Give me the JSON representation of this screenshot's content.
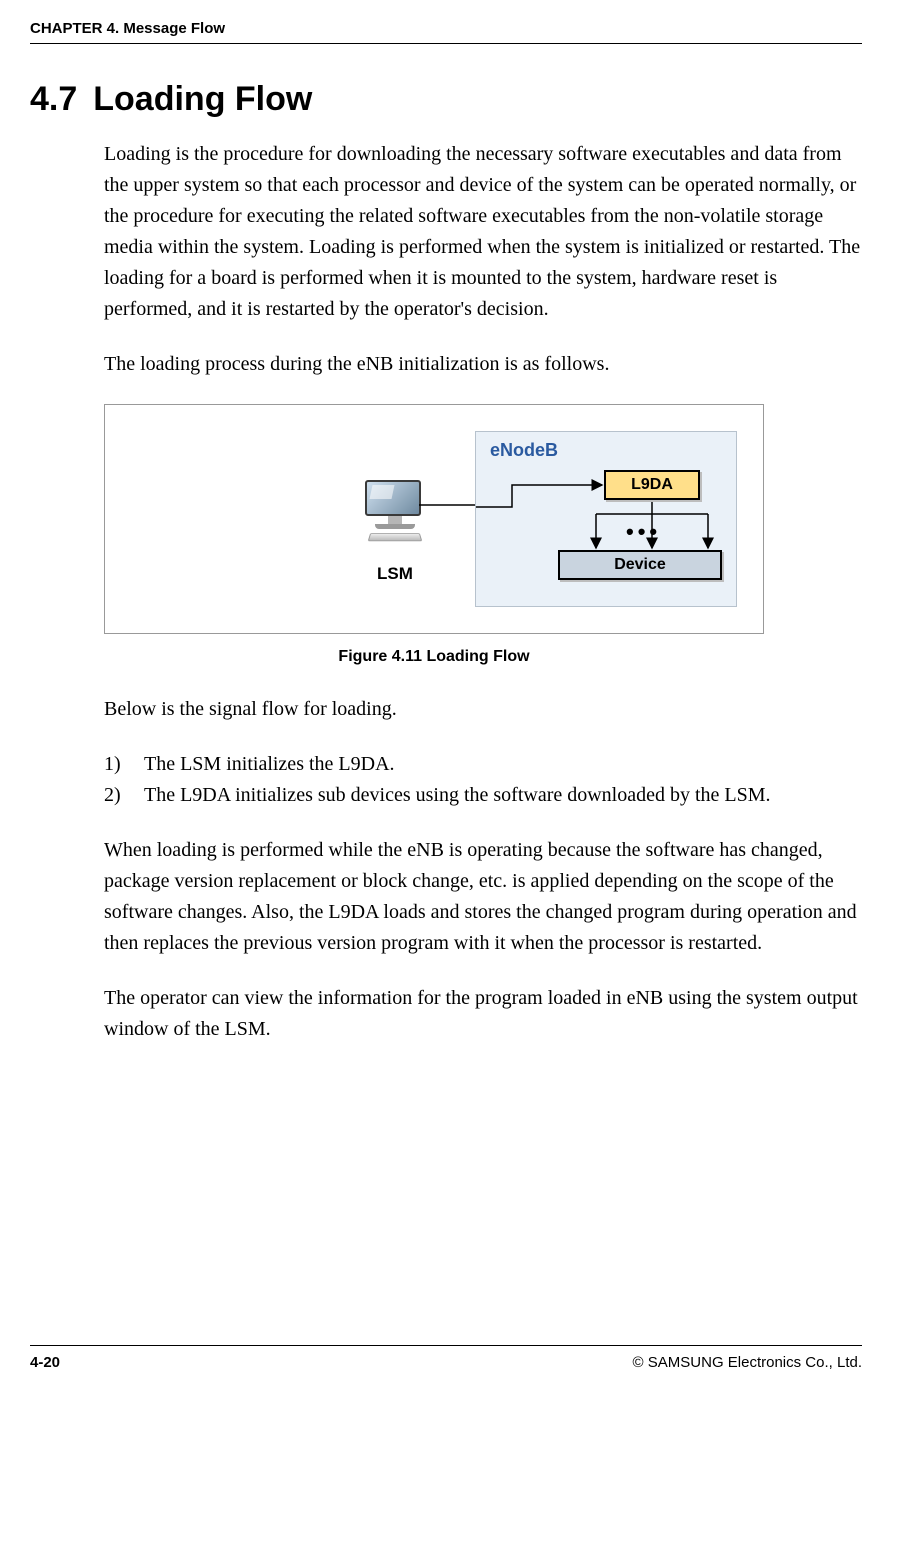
{
  "running_head": "CHAPTER 4. Message Flow",
  "section": {
    "number": "4.7",
    "title": "Loading Flow"
  },
  "para1": "Loading is the procedure for downloading the necessary software executables and data from the upper system so that each processor and device of the system can be operated normally, or the procedure for executing the related software executables from the non-volatile storage media within the system. Loading is performed when the system is initialized or restarted. The loading for a board is performed when it is mounted to the system, hardware reset is performed, and it is restarted by the operator's decision.",
  "para2": "The loading process during the eNB initialization is as follows.",
  "figure": {
    "lsm_label": "LSM",
    "enb_label": "eNodeB",
    "l9da_label": "L9DA",
    "device_label": "Device",
    "dots": "•••",
    "caption": "Figure 4.11    Loading Flow"
  },
  "para3": "Below is the signal flow for loading.",
  "steps": [
    {
      "num": "1)",
      "text": "The LSM initializes the L9DA."
    },
    {
      "num": "2)",
      "text": "The L9DA initializes sub devices using the software downloaded by the LSM."
    }
  ],
  "para4": "When loading is performed while the eNB is operating because the software has changed, package version replacement or block change, etc. is applied depending on the scope of the software changes. Also, the L9DA loads and stores the changed program during operation and then replaces the previous version program with it when the processor is restarted.",
  "para5": "The operator can view the information for the program loaded in eNB using the system output window of the LSM.",
  "footer": {
    "page": "4-20",
    "copyright": "© SAMSUNG Electronics Co., Ltd."
  },
  "chart_data": {
    "type": "diagram",
    "nodes": [
      "LSM",
      "eNodeB",
      "L9DA",
      "Device"
    ],
    "edges": [
      {
        "from": "LSM",
        "to": "L9DA"
      },
      {
        "from": "L9DA",
        "to": "Device",
        "multiplicity": "many"
      }
    ]
  }
}
